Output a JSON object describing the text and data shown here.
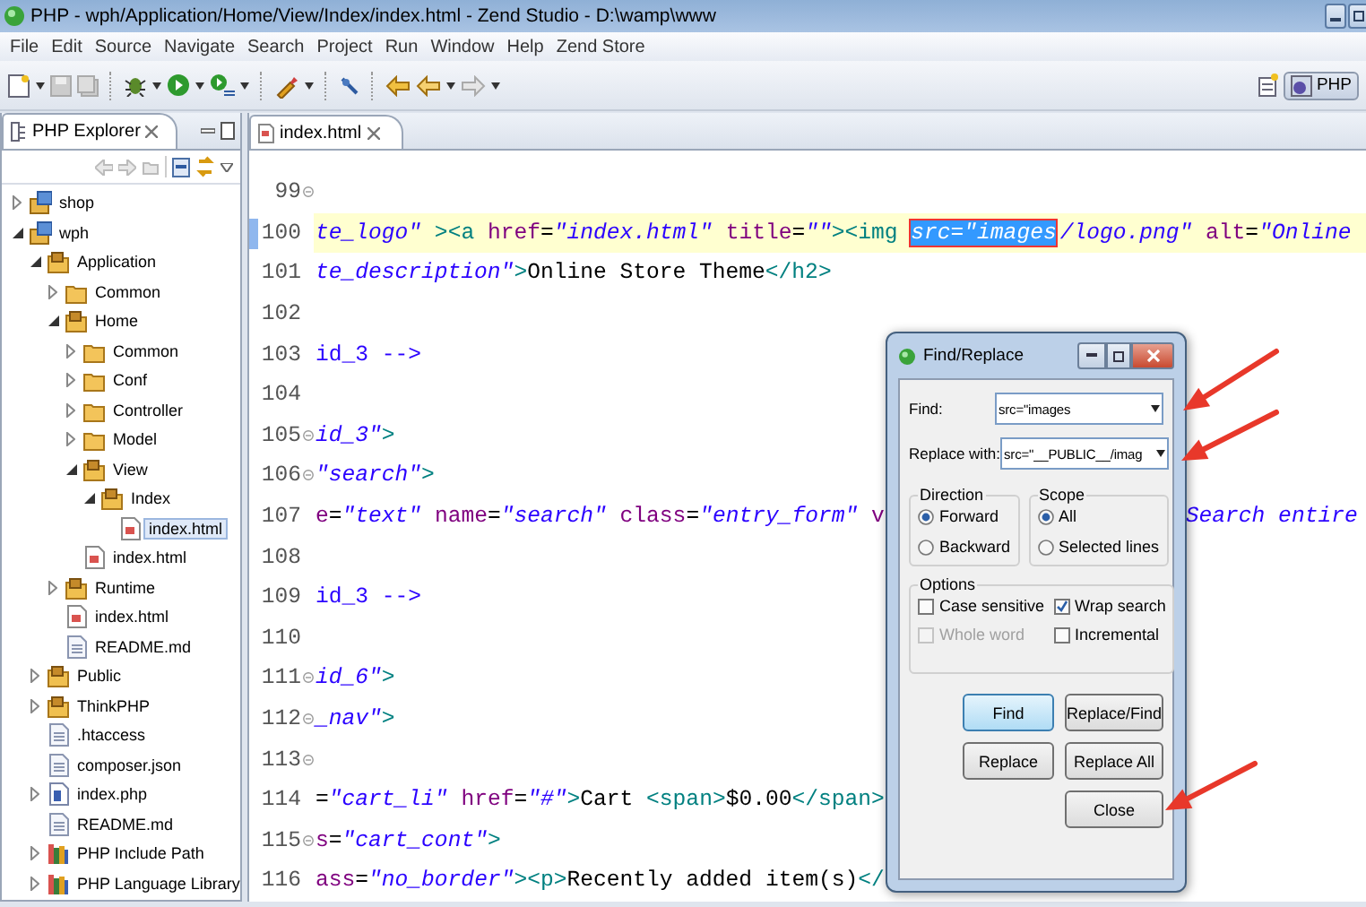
{
  "window": {
    "title": "PHP - wph/Application/Home/View/Index/index.html - Zend Studio - D:\\wamp\\www"
  },
  "menu": [
    "File",
    "Edit",
    "Source",
    "Navigate",
    "Search",
    "Project",
    "Run",
    "Window",
    "Help",
    "Zend Store"
  ],
  "perspective": {
    "label": "PHP",
    "selected": true
  },
  "explorer": {
    "title": "PHP Explorer",
    "items": [
      {
        "label": "shop",
        "kind": "project",
        "expanded": false,
        "selected": false
      },
      {
        "label": "wph",
        "kind": "project",
        "expanded": true,
        "selected": false,
        "children": [
          {
            "label": "Application",
            "kind": "package",
            "expanded": true,
            "selected": false,
            "children": [
              {
                "label": "Common",
                "kind": "folder",
                "expanded": false,
                "selected": false
              },
              {
                "label": "Home",
                "kind": "package",
                "expanded": true,
                "selected": false,
                "children": [
                  {
                    "label": "Common",
                    "kind": "folder",
                    "expanded": false,
                    "selected": false
                  },
                  {
                    "label": "Conf",
                    "kind": "folder",
                    "expanded": false,
                    "selected": false
                  },
                  {
                    "label": "Controller",
                    "kind": "folder",
                    "expanded": false,
                    "selected": false
                  },
                  {
                    "label": "Model",
                    "kind": "folder",
                    "expanded": false,
                    "selected": false
                  },
                  {
                    "label": "View",
                    "kind": "package",
                    "expanded": true,
                    "selected": false,
                    "children": [
                      {
                        "label": "Index",
                        "kind": "package",
                        "expanded": true,
                        "selected": false,
                        "children": [
                          {
                            "label": "index.html",
                            "kind": "html",
                            "selected": true
                          }
                        ]
                      }
                    ]
                  },
                  {
                    "label": "index.html",
                    "kind": "html",
                    "selected": false
                  }
                ]
              },
              {
                "label": "Runtime",
                "kind": "package",
                "expanded": false,
                "selected": false
              },
              {
                "label": "index.html",
                "kind": "html",
                "selected": false
              },
              {
                "label": "README.md",
                "kind": "text",
                "selected": false
              }
            ]
          },
          {
            "label": "Public",
            "kind": "package",
            "expanded": false,
            "selected": false
          },
          {
            "label": "ThinkPHP",
            "kind": "package",
            "expanded": false,
            "selected": false
          },
          {
            "label": ".htaccess",
            "kind": "text",
            "selected": false
          },
          {
            "label": "composer.json",
            "kind": "text",
            "selected": false
          },
          {
            "label": "index.php",
            "kind": "php",
            "expanded": false,
            "selected": false
          },
          {
            "label": "README.md",
            "kind": "text",
            "selected": false
          },
          {
            "label": "PHP Include Path",
            "kind": "library",
            "expanded": false,
            "selected": false
          },
          {
            "label": "PHP Language Library",
            "kind": "library",
            "expanded": false,
            "selected": false
          }
        ]
      }
    ]
  },
  "editor": {
    "tab": "index.html",
    "lines": [
      {
        "number": "99",
        "fold": true,
        "current": false
      },
      {
        "number": "100",
        "fold": false,
        "current": true,
        "segments": [
          {
            "text": "te_logo\"",
            "kind": "string"
          },
          {
            "text": " >",
            "kind": "tag"
          },
          {
            "text": "<a ",
            "kind": "tag"
          },
          {
            "text": "href",
            "kind": "attr"
          },
          {
            "text": "=",
            "kind": "text"
          },
          {
            "text": "\"index.html\"",
            "kind": "string"
          },
          {
            "text": " title",
            "kind": "attr"
          },
          {
            "text": "=",
            "kind": "text"
          },
          {
            "text": "\"\"",
            "kind": "string"
          },
          {
            "text": "><img ",
            "kind": "tag"
          },
          {
            "text": "src=\"images",
            "kind": "selection"
          },
          {
            "text": "/logo.png\"",
            "kind": "string"
          },
          {
            "text": " alt",
            "kind": "attr"
          },
          {
            "text": "=",
            "kind": "text"
          },
          {
            "text": "\"Online",
            "kind": "string"
          }
        ]
      },
      {
        "number": "101",
        "fold": false,
        "current": false,
        "segments": [
          {
            "text": "te_description\"",
            "kind": "string"
          },
          {
            "text": ">",
            "kind": "tag"
          },
          {
            "text": "Online Store Theme",
            "kind": "text"
          },
          {
            "text": "</h2>",
            "kind": "tag"
          }
        ]
      },
      {
        "number": "102",
        "fold": false,
        "current": false
      },
      {
        "number": "103",
        "fold": false,
        "current": false,
        "segments": [
          {
            "text": "id_3 -->",
            "kind": "comment"
          }
        ]
      },
      {
        "number": "104",
        "fold": false,
        "current": false
      },
      {
        "number": "105",
        "fold": true,
        "current": false,
        "segments": [
          {
            "text": "id_3\"",
            "kind": "string"
          },
          {
            "text": ">",
            "kind": "tag"
          }
        ]
      },
      {
        "number": "106",
        "fold": true,
        "current": false,
        "segments": [
          {
            "text": "\"search\"",
            "kind": "string"
          },
          {
            "text": ">",
            "kind": "tag"
          }
        ]
      },
      {
        "number": "107",
        "fold": false,
        "current": false,
        "segments": [
          {
            "text": "e",
            "kind": "attr"
          },
          {
            "text": "=",
            "kind": "text"
          },
          {
            "text": "\"text\"",
            "kind": "string"
          },
          {
            "text": " name",
            "kind": "attr"
          },
          {
            "text": "=",
            "kind": "text"
          },
          {
            "text": "\"search\"",
            "kind": "string"
          },
          {
            "text": " class",
            "kind": "attr"
          },
          {
            "text": "=",
            "kind": "text"
          },
          {
            "text": "\"entry_form\"",
            "kind": "string"
          },
          {
            "text": " v",
            "kind": "attr"
          },
          {
            "text": "Search entire",
            "kind": "far-string"
          }
        ]
      },
      {
        "number": "108",
        "fold": false,
        "current": false
      },
      {
        "number": "109",
        "fold": false,
        "current": false,
        "segments": [
          {
            "text": "id_3 -->",
            "kind": "comment"
          }
        ]
      },
      {
        "number": "110",
        "fold": false,
        "current": false
      },
      {
        "number": "111",
        "fold": true,
        "current": false,
        "segments": [
          {
            "text": "id_6\"",
            "kind": "string"
          },
          {
            "text": ">",
            "kind": "tag"
          }
        ]
      },
      {
        "number": "112",
        "fold": true,
        "current": false,
        "segments": [
          {
            "text": "_nav\"",
            "kind": "string"
          },
          {
            "text": ">",
            "kind": "tag"
          }
        ]
      },
      {
        "number": "113",
        "fold": true,
        "current": false
      },
      {
        "number": "114",
        "fold": false,
        "current": false,
        "segments": [
          {
            "text": "=",
            "kind": "text"
          },
          {
            "text": "\"cart_li\"",
            "kind": "string"
          },
          {
            "text": " href",
            "kind": "attr"
          },
          {
            "text": "=",
            "kind": "text"
          },
          {
            "text": "\"#\"",
            "kind": "string"
          },
          {
            "text": ">",
            "kind": "tag"
          },
          {
            "text": "Cart ",
            "kind": "text"
          },
          {
            "text": "<span>",
            "kind": "tag"
          },
          {
            "text": "$0.00",
            "kind": "text"
          },
          {
            "text": "</span>",
            "kind": "tag"
          }
        ]
      },
      {
        "number": "115",
        "fold": true,
        "current": false,
        "segments": [
          {
            "text": "s",
            "kind": "attr"
          },
          {
            "text": "=",
            "kind": "text"
          },
          {
            "text": "\"cart_cont\"",
            "kind": "string"
          },
          {
            "text": ">",
            "kind": "tag"
          }
        ]
      },
      {
        "number": "116",
        "fold": false,
        "current": false,
        "segments": [
          {
            "text": "ass",
            "kind": "attr"
          },
          {
            "text": "=",
            "kind": "text"
          },
          {
            "text": "\"no_border\"",
            "kind": "string"
          },
          {
            "text": "><p>",
            "kind": "tag"
          },
          {
            "text": "Recently added item(s)",
            "kind": "text"
          },
          {
            "text": "</",
            "kind": "tag"
          }
        ]
      }
    ]
  },
  "dialog": {
    "title": "Find/Replace",
    "fields": [
      {
        "label": "Find:",
        "value": "src=\"images"
      },
      {
        "label": "Replace with:",
        "value": "src=\"__PUBLIC__/imag"
      }
    ],
    "groups": [
      {
        "title": "Direction",
        "options": [
          {
            "label": "Forward",
            "selected": true
          },
          {
            "label": "Backward",
            "selected": false
          }
        ]
      },
      {
        "title": "Scope",
        "options": [
          {
            "label": "All",
            "selected": true
          },
          {
            "label": "Selected lines",
            "selected": false
          }
        ]
      }
    ],
    "options": {
      "title": "Options",
      "items": [
        {
          "label": "Case sensitive",
          "checked": false,
          "disabled": false
        },
        {
          "label": "Wrap search",
          "checked": true,
          "disabled": false
        },
        {
          "label": "Whole word",
          "checked": false,
          "disabled": true
        },
        {
          "label": "Incremental",
          "checked": false,
          "disabled": false
        }
      ]
    },
    "buttons": [
      {
        "label": "Find",
        "default": true
      },
      {
        "label": "Replace/Find",
        "default": false
      },
      {
        "label": "Replace",
        "default": false
      },
      {
        "label": "Replace All",
        "default": false
      },
      {
        "label": "Close",
        "default": false
      }
    ]
  }
}
